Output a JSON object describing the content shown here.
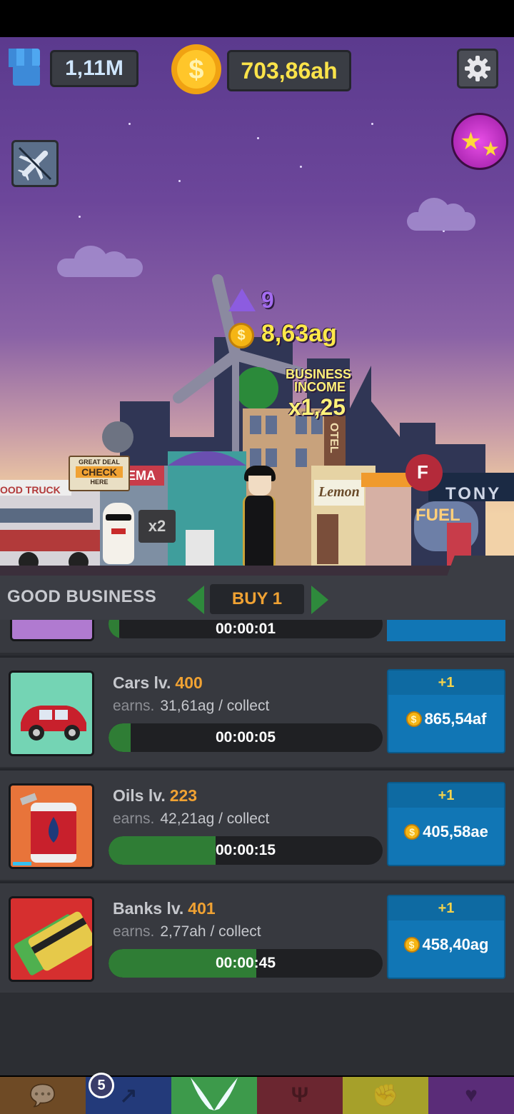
{
  "hud": {
    "power_value": "1,11M",
    "coins_value": "703,86ah"
  },
  "scene": {
    "illuminati_count": "9",
    "income_value": "8,63ag",
    "multiplier_label_1": "BUSINESS",
    "multiplier_label_2": "INCOME",
    "multiplier_value": "x1,25",
    "sign_line1": "GREAT DEAL",
    "sign_line2": "CHECK",
    "sign_line3": "HERE",
    "x2_badge": "x2",
    "food_truck_sign": "OOD TRUCK",
    "cinema_sign": "EMA",
    "hotel_sign": "OTEL",
    "lemon_sign": "Lemon",
    "fuel_sign": "FUEL",
    "tony_sign": "TONY",
    "f_badge": "F"
  },
  "panel": {
    "title": "GOOD BUSINESS",
    "buy_mode": "BUY 1",
    "partial_row_timer": "00:00:01",
    "rows": [
      {
        "name": "Cars lv.",
        "level": "400",
        "earn_label": "earns.",
        "earn_value": "31,61ag / collect",
        "timer": "00:00:05",
        "progress": 0.08,
        "buy_top": "+1",
        "price": "865,54af"
      },
      {
        "name": "Oils lv.",
        "level": "223",
        "earn_label": "earns.",
        "earn_value": "42,21ag / collect",
        "timer": "00:00:15",
        "progress": 0.39,
        "buy_top": "+1",
        "price": "405,58ae"
      },
      {
        "name": "Banks lv.",
        "level": "401",
        "earn_label": "earns.",
        "earn_value": "2,77ah / collect",
        "timer": "00:00:45",
        "progress": 0.54,
        "buy_top": "+1",
        "price": "458,40ag"
      }
    ]
  },
  "nav": {
    "badge_count": "5",
    "tabs": [
      {
        "icon": "chat-bubble-icon",
        "color": "#6e4a25"
      },
      {
        "icon": "trend-arrow-icon",
        "color": "#233a7a"
      },
      {
        "icon": "angel-wings-icon",
        "color": "#3d9a4b"
      },
      {
        "icon": "trident-icon",
        "color": "#6b2630"
      },
      {
        "icon": "fist-icon",
        "color": "#a6a02a"
      },
      {
        "icon": "heart-icon",
        "color": "#5a2c78"
      }
    ]
  }
}
